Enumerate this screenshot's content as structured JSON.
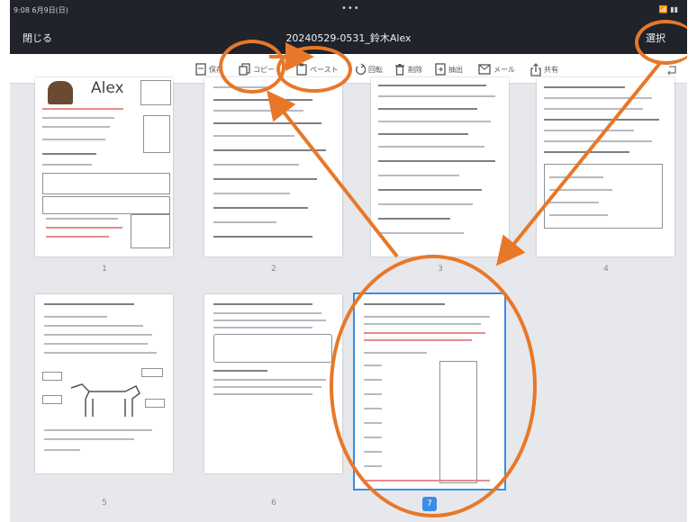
{
  "status_bar": {
    "time": "9:08 6月9日(日)",
    "dots": "•••",
    "right": "📶 ▮▮"
  },
  "navbar": {
    "close_label": "閉じる",
    "title": "20240529-0531_鈴木Alex",
    "select_label": "選択"
  },
  "toolbar": {
    "items": [
      {
        "label": "保存",
        "icon": "file-icon"
      },
      {
        "label": "コピー",
        "icon": "copy-icon"
      },
      {
        "label": "ペースト",
        "icon": "paste-icon"
      },
      {
        "label": "回転",
        "icon": "rotate-icon"
      },
      {
        "label": "削除",
        "icon": "trash-icon"
      },
      {
        "label": "抽出",
        "icon": "extract-icon"
      },
      {
        "label": "メール",
        "icon": "mail-icon"
      },
      {
        "label": "共有",
        "icon": "share-icon"
      }
    ]
  },
  "pages": [
    {
      "number": "1",
      "heading": "Alex"
    },
    {
      "number": "2"
    },
    {
      "number": "3"
    },
    {
      "number": "4"
    },
    {
      "number": "5"
    },
    {
      "number": "6"
    },
    {
      "number": "7",
      "selected": true
    }
  ],
  "colors": {
    "accent": "#3a8ee6",
    "annotation": "#e77828",
    "navbar": "#202329",
    "background": "#e7e8ec"
  }
}
